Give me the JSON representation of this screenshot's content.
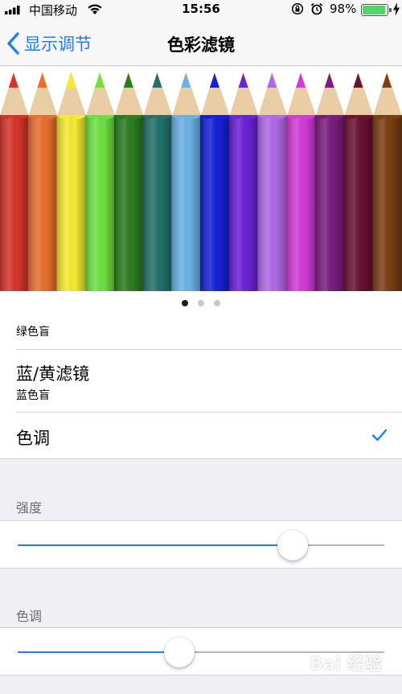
{
  "status_bar": {
    "carrier": "中国移动",
    "time": "15:56",
    "battery_percent": "98%",
    "battery_level": 0.98,
    "battery_color": "#4cd964"
  },
  "nav": {
    "back_label": "显示调节",
    "title": "色彩滤镜",
    "accent_color": "#1f7ef3"
  },
  "carousel": {
    "pages": 3,
    "active_page": 0,
    "pencil_colors": [
      "#d6342a",
      "#e8702f",
      "#f4ea2f",
      "#6fe040",
      "#2a7d1e",
      "#22706b",
      "#6ab2e6",
      "#1420d8",
      "#6b22d8",
      "#b06ae6",
      "#d33bd8",
      "#7a1c7e",
      "#6a1231",
      "#7a3f13"
    ]
  },
  "filters": {
    "partial_row_sub": "绿色盲",
    "blue_yellow": {
      "label": "蓝/黄滤镜",
      "sub": "蓝色盲"
    },
    "tint": {
      "label": "色调",
      "selected": true
    }
  },
  "intensity": {
    "header": "强度",
    "value": 0.75
  },
  "hue": {
    "header": "色调",
    "value": 0.44
  },
  "watermark": "Bai 经验"
}
